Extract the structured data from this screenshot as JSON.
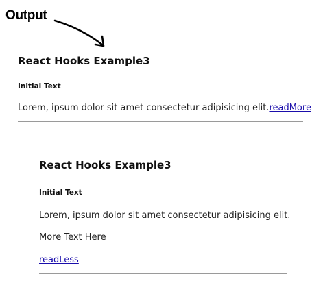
{
  "annotation": {
    "label": "Output"
  },
  "demo_before": {
    "title": "React Hooks Example3",
    "subtitle": "Initial Text",
    "text": "Lorem, ipsum dolor sit amet consectetur adipisicing elit.",
    "toggle_link": "readMore"
  },
  "demo_after": {
    "title": "React Hooks Example3",
    "subtitle": "Initial Text",
    "text": "Lorem, ipsum dolor sit amet consectetur adipisicing elit.",
    "more_text": "More Text Here",
    "toggle_link": "readLess"
  },
  "colors": {
    "link": "#1a0dab",
    "rule": "#9a9a9a"
  }
}
